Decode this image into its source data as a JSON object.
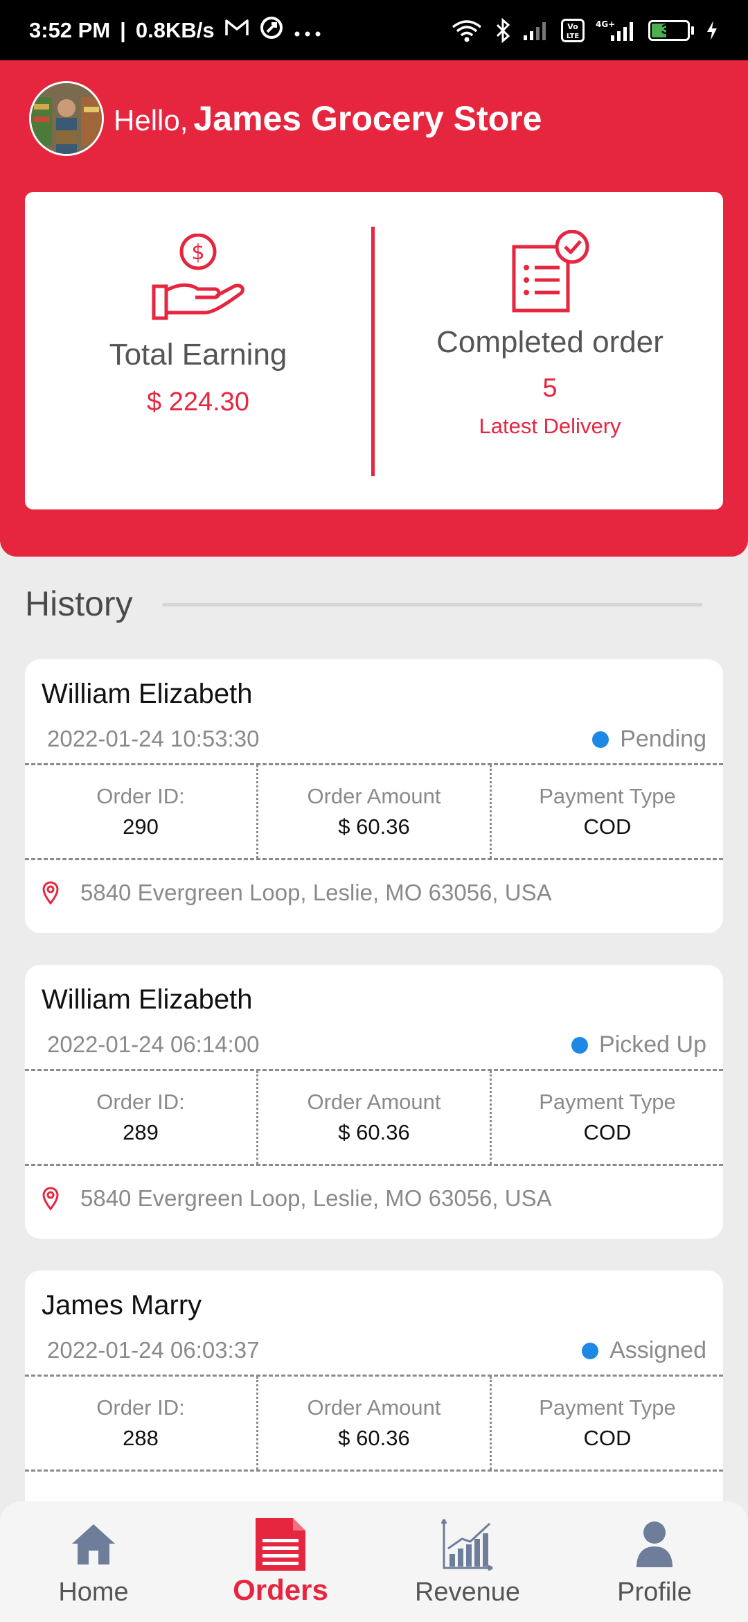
{
  "status_bar": {
    "time": "3:52 PM",
    "speed": "0.8KB/s",
    "battery": "39",
    "network": "4G+",
    "volte": "Vo LTE"
  },
  "header": {
    "greeting": "Hello,",
    "store_name": "James Grocery Store"
  },
  "stats": {
    "earning_title": "Total Earning",
    "earning_value": "$ 224.30",
    "completed_title": "Completed order",
    "completed_value": "5",
    "latest_delivery": "Latest Delivery"
  },
  "history": {
    "title": "History",
    "label_order_id": "Order ID:",
    "label_amount": "Order Amount",
    "label_payment": "Payment Type",
    "orders": [
      {
        "customer": "William Elizabeth",
        "date": "2022-01-24 10:53:30",
        "status": "Pending",
        "order_id": "290",
        "amount": "$ 60.36",
        "payment": "COD",
        "address": "5840 Evergreen Loop, Leslie, MO 63056, USA"
      },
      {
        "customer": "William Elizabeth",
        "date": "2022-01-24 06:14:00",
        "status": "Picked Up",
        "order_id": "289",
        "amount": "$ 60.36",
        "payment": "COD",
        "address": "5840 Evergreen Loop, Leslie, MO 63056, USA"
      },
      {
        "customer": "James Marry",
        "date": "2022-01-24 06:03:37",
        "status": "Assigned",
        "order_id": "288",
        "amount": "$ 60.36",
        "payment": "COD",
        "address": ""
      }
    ]
  },
  "nav": {
    "home": "Home",
    "orders": "Orders",
    "revenue": "Revenue",
    "profile": "Profile",
    "active": "orders"
  },
  "colors": {
    "brand": "#e6263f",
    "status_dot": "#1e88e5",
    "nav_icon": "#6e7d99"
  }
}
